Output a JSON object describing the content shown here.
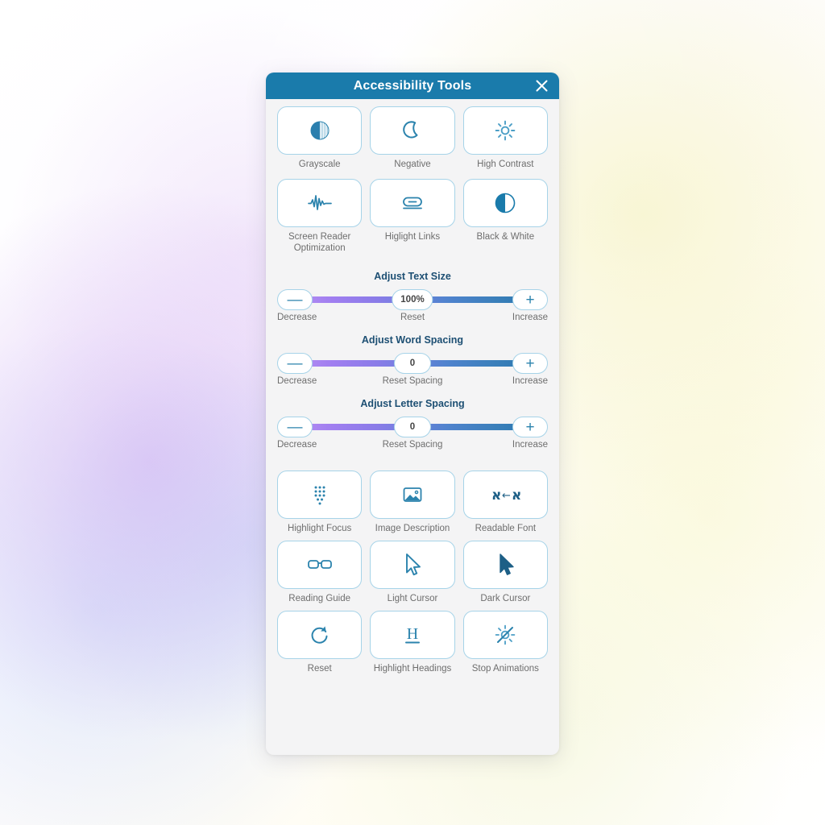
{
  "header": {
    "title": "Accessibility Tools",
    "close_icon": "close-icon"
  },
  "top_tiles": [
    {
      "label": "Grayscale",
      "icon": "grayscale-circle-icon"
    },
    {
      "label": "Negative",
      "icon": "moon-icon"
    },
    {
      "label": "High Contrast",
      "icon": "sun-icon"
    },
    {
      "label": "Screen Reader Optimization",
      "icon": "waveform-icon"
    },
    {
      "label": "Higlight Links",
      "icon": "link-icon"
    },
    {
      "label": "Black & White",
      "icon": "half-circle-icon"
    }
  ],
  "sliders": [
    {
      "title": "Adjust Text Size",
      "decrease_label": "Decrease",
      "reset_label": "Reset",
      "increase_label": "Increase",
      "value": "100%",
      "minus": "—",
      "plus": "+"
    },
    {
      "title": "Adjust Word Spacing",
      "decrease_label": "Decrease",
      "reset_label": "Reset Spacing",
      "increase_label": "Increase",
      "value": "0",
      "minus": "—",
      "plus": "+"
    },
    {
      "title": "Adjust Letter Spacing",
      "decrease_label": "Decrease",
      "reset_label": "Reset Spacing",
      "increase_label": "Increase",
      "value": "0",
      "minus": "—",
      "plus": "+"
    }
  ],
  "bottom_tiles": [
    {
      "label": "Highlight Focus",
      "icon": "dot-grid-icon"
    },
    {
      "label": "Image Description",
      "icon": "image-icon"
    },
    {
      "label": "Readable Font",
      "icon": "readable-font-icon"
    },
    {
      "label": "Reading Guide",
      "icon": "glasses-icon"
    },
    {
      "label": "Light Cursor",
      "icon": "cursor-outline-icon"
    },
    {
      "label": "Dark Cursor",
      "icon": "cursor-filled-icon"
    },
    {
      "label": "Reset",
      "icon": "refresh-icon"
    },
    {
      "label": "Highlight Headings",
      "icon": "heading-h-icon"
    },
    {
      "label": "Stop Animations",
      "icon": "sun-slash-icon"
    }
  ],
  "colors": {
    "header_blue": "#1a7bab",
    "icon_blue": "#2b83ad",
    "tile_border": "#a6d3e8",
    "panel_bg": "#f4f4f5",
    "label_gray": "#6e6e6e",
    "slider_title": "#1d4f73",
    "track_start": "#b18cf2",
    "track_end": "#2f79b2"
  }
}
